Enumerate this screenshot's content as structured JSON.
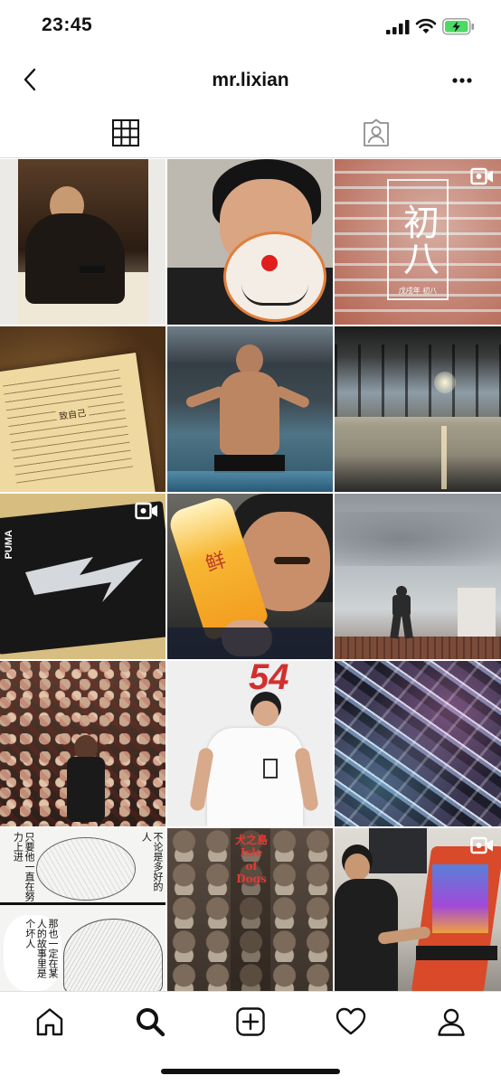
{
  "status_bar": {
    "time": "23:45",
    "icons": [
      "signal-icon",
      "wifi-icon",
      "battery-charging-icon"
    ],
    "battery_color": "#4cd964"
  },
  "header": {
    "username": "mr.lixian",
    "back_icon": "chevron-left-icon",
    "more_icon": "more-horizontal-icon"
  },
  "tabs": [
    {
      "name": "grid",
      "icon": "grid-icon",
      "active": true
    },
    {
      "name": "tagged",
      "icon": "tagged-person-icon",
      "active": false
    }
  ],
  "posts": [
    {
      "id": 1,
      "subject": "man seated at desk",
      "video": false
    },
    {
      "id": 2,
      "subject": "man holding Doraemon balloon",
      "video": false
    },
    {
      "id": 3,
      "subject": "red wall with calligraphy",
      "video": true,
      "title": "初八",
      "subtitle": "戊戌年 初八"
    },
    {
      "id": 4,
      "subject": "printed page",
      "video": false,
      "text": "致自己"
    },
    {
      "id": 5,
      "subject": "man in swimming pool",
      "video": false
    },
    {
      "id": 6,
      "subject": "glass hall with reflections",
      "video": false
    },
    {
      "id": 7,
      "subject": "black box with lightning bolt",
      "video": true,
      "brand": "PUMA"
    },
    {
      "id": 8,
      "subject": "man with juice bottle",
      "video": false,
      "label": "鲜"
    },
    {
      "id": 9,
      "subject": "man standing on rooftop",
      "video": false
    },
    {
      "id": 10,
      "subject": "crowd in arena",
      "video": false
    },
    {
      "id": 11,
      "subject": "man in white t-shirt",
      "video": false,
      "number": "54"
    },
    {
      "id": 12,
      "subject": "holographic wrapped packages",
      "video": false
    },
    {
      "id": 13,
      "subject": "manga panels",
      "video": false,
      "bubbles": [
        "只要他一直在努力上进",
        "不论是多好的人",
        "那也一定在某人的故事里是个坏人"
      ]
    },
    {
      "id": 14,
      "subject": "dog figurines",
      "video": false,
      "text": "犬之島 Isle of Dogs"
    },
    {
      "id": 15,
      "subject": "man at arcade machine",
      "video": true
    }
  ],
  "bottom_nav": [
    {
      "name": "home",
      "icon": "home-icon"
    },
    {
      "name": "search",
      "icon": "search-icon",
      "active": true
    },
    {
      "name": "new-post",
      "icon": "plus-square-icon"
    },
    {
      "name": "activity",
      "icon": "heart-icon"
    },
    {
      "name": "profile",
      "icon": "profile-icon"
    }
  ],
  "colors": {
    "text": "#111111",
    "divider": "#dbdbdb",
    "accent_red": "#d32f2f"
  }
}
